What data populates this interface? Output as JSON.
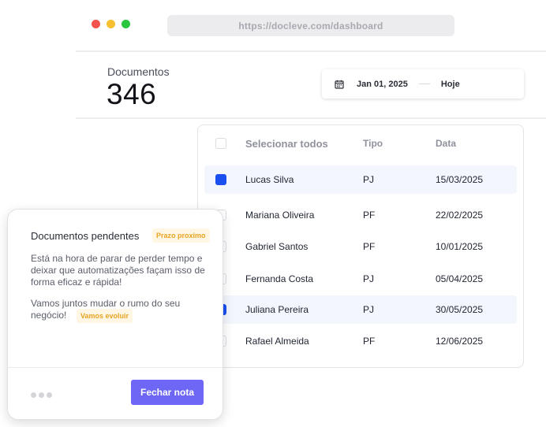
{
  "browser": {
    "url": "https://docleve.com/dashboard"
  },
  "stats": {
    "documents_label": "Documentos",
    "documents_count": "346"
  },
  "date_range": {
    "start": "Jan 01, 2025",
    "end": "Hoje"
  },
  "table": {
    "headers": {
      "select_all": "Selecionar todos",
      "type": "Tipo",
      "date": "Data"
    },
    "rows": [
      {
        "name": "Lucas Silva",
        "type": "PJ",
        "date": "15/03/2025",
        "selected": true
      },
      {
        "name": "Mariana Oliveira",
        "type": "PF",
        "date": "22/02/2025",
        "selected": false
      },
      {
        "name": "Gabriel Santos",
        "type": "PF",
        "date": "10/01/2025",
        "selected": false
      },
      {
        "name": "Fernanda Costa",
        "type": "PJ",
        "date": "05/04/2025",
        "selected": false
      },
      {
        "name": "Juliana Pereira",
        "type": "PJ",
        "date": "30/05/2025",
        "selected": true
      },
      {
        "name": "Rafael Almeida",
        "type": "PF",
        "date": "12/06/2025",
        "selected": false
      }
    ]
  },
  "note": {
    "title": "Documentos pendentes",
    "badge_deadline": "Prazo proximo",
    "paragraph1": "Está na hora de parar de perder tempo e deixar que automatizações façam isso de forma eficaz e rápida!",
    "paragraph2": "Vamos juntos mudar o rumo do seu negócio!",
    "badge_evolve": "Vamos evoluir",
    "close_label": "Fechar nota"
  },
  "colors": {
    "accent": "#6e66f4",
    "checkbox_checked": "#1a4ff0",
    "badge_text": "#e7a523"
  },
  "icons": {
    "date": "calendar-icon"
  }
}
